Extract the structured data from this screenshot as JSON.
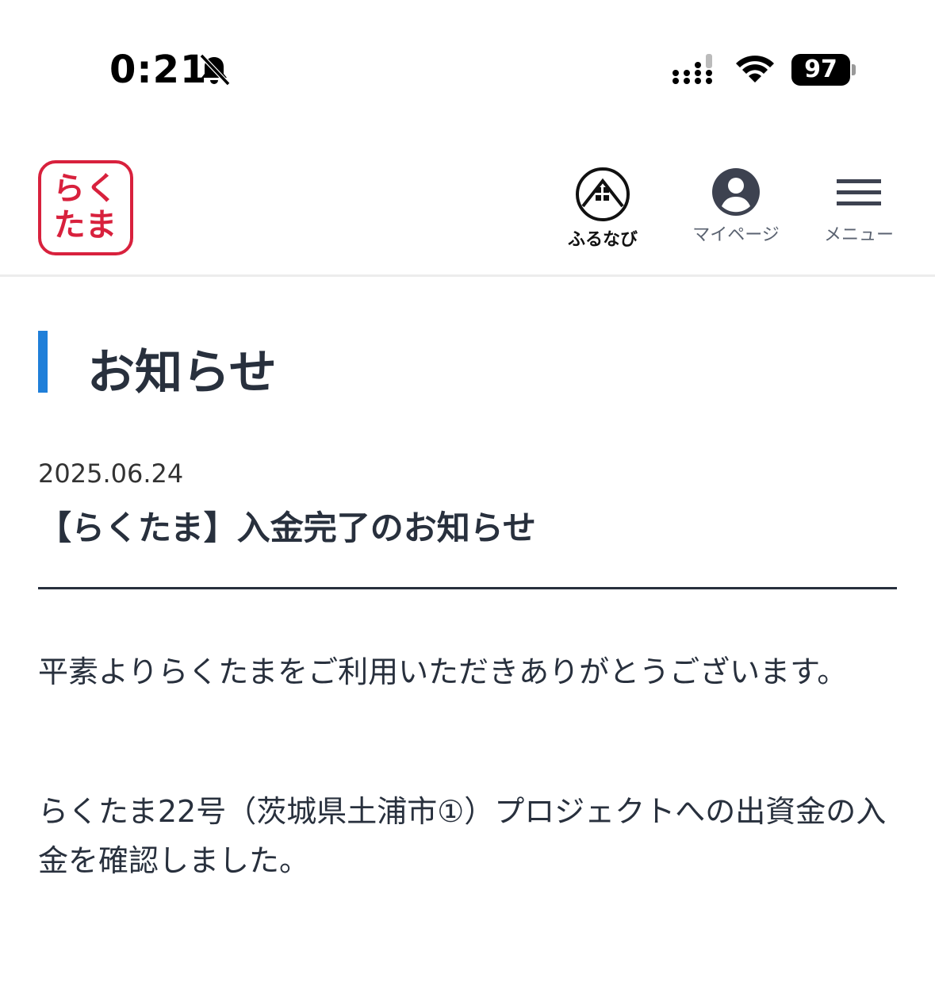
{
  "status_bar": {
    "time": "0:21",
    "battery": "97",
    "icons": [
      "bell-slash-icon",
      "cellular-signal-icon",
      "wifi-icon",
      "battery-icon"
    ]
  },
  "header": {
    "logo": {
      "line1": "らく",
      "line2": "たま",
      "color": "#d8213d"
    },
    "nav": {
      "furunavi": "ふるなび",
      "mypage": "マイページ",
      "menu": "メニュー"
    }
  },
  "main": {
    "page_title": "お知らせ",
    "accent_color": "#1f7fd9",
    "notice": {
      "date": "2025.06.24",
      "title": "【らくたま】入金完了のお知らせ",
      "paragraphs": [
        "平素よりらくたまをご利用いただきありがとうございます。",
        "らくたま22号（茨城県土浦市①）プロジェクトへの出資金の入金を確認しました。"
      ]
    }
  }
}
